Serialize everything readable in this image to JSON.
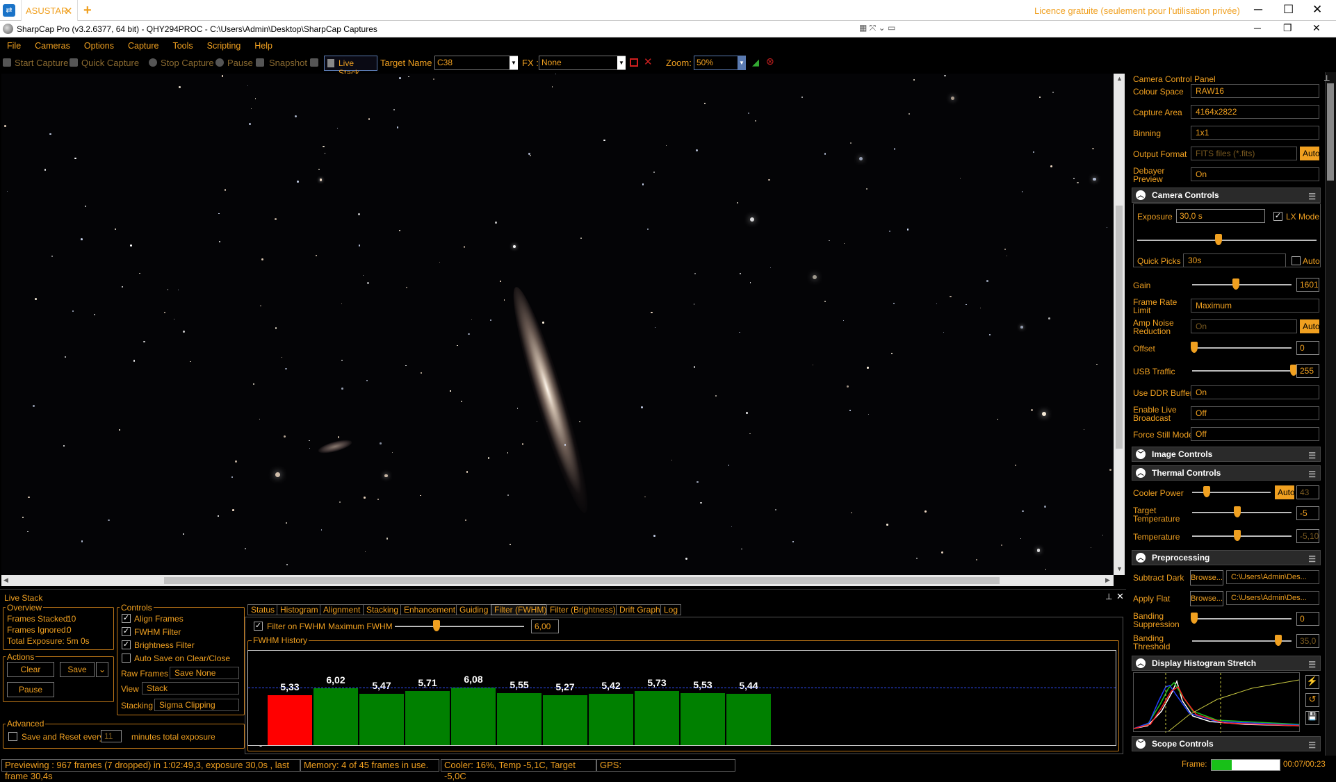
{
  "browser_tab": {
    "title": "ASUSTAR",
    "close": "✕",
    "new": "+",
    "licence": "Licence gratuite (seulement pour l'utilisation privée)"
  },
  "window": {
    "title": "SharpCap Pro (v3.2.6377, 64 bit) - QHY294PROC - C:\\Users\\Admin\\Desktop\\SharpCap Captures"
  },
  "menu": [
    "File",
    "Cameras",
    "Options",
    "Capture",
    "Tools",
    "Scripting",
    "Help"
  ],
  "toolbar": {
    "start_capture": "Start Capture",
    "quick_capture": "Quick Capture",
    "stop_capture": "Stop Capture",
    "pause": "Pause",
    "snapshot": "Snapshot",
    "live_stack": "Live Stack",
    "target_label": "Target Name :",
    "target_value": "C38",
    "fx_label": "FX :",
    "fx_value": "None",
    "zoom_label": "Zoom:",
    "zoom_value": "50%"
  },
  "ccp": {
    "title": "Camera Control Panel",
    "colour_space": {
      "label": "Colour Space",
      "value": "RAW16"
    },
    "capture_area": {
      "label": "Capture Area",
      "value": "4164x2822"
    },
    "binning": {
      "label": "Binning",
      "value": "1x1"
    },
    "output_format": {
      "label": "Output Format",
      "value": "FITS files (*.fits)",
      "auto": "Auto"
    },
    "debayer": {
      "label1": "Debayer",
      "label2": "Preview",
      "value": "On"
    },
    "camera_controls": "Camera Controls",
    "exposure": {
      "label": "Exposure",
      "value": "30,0 s",
      "lx_label": "LX Mode"
    },
    "quick_picks": {
      "label": "Quick Picks",
      "value": "30s",
      "auto": "Auto"
    },
    "gain": {
      "label": "Gain",
      "value": "1601"
    },
    "frame_rate": {
      "label1": "Frame Rate",
      "label2": "Limit",
      "value": "Maximum"
    },
    "amp_noise": {
      "label1": "Amp Noise",
      "label2": "Reduction",
      "value": "On",
      "auto": "Auto"
    },
    "offset": {
      "label": "Offset",
      "value": "0"
    },
    "usb": {
      "label": "USB Traffic",
      "value": "255"
    },
    "ddr": {
      "label": "Use DDR Buffer",
      "value": "On"
    },
    "broadcast": {
      "label1": "Enable Live",
      "label2": "Broadcast",
      "value": "Off"
    },
    "force_still": {
      "label": "Force Still Mode",
      "value": "Off"
    },
    "image_controls": "Image Controls",
    "thermal_controls": "Thermal Controls",
    "cooler_power": {
      "label": "Cooler Power",
      "auto": "Auto",
      "value": "43"
    },
    "target_temp": {
      "label1": "Target",
      "label2": "Temperature",
      "value": "-5"
    },
    "temperature": {
      "label": "Temperature",
      "value": "-5,10"
    },
    "preprocessing": "Preprocessing",
    "subtract_dark": {
      "label": "Subtract Dark",
      "browse": "Browse...",
      "value": "C:\\Users\\Admin\\Des..."
    },
    "apply_flat": {
      "label": "Apply Flat",
      "browse": "Browse...",
      "value": "C:\\Users\\Admin\\Des..."
    },
    "banding_supp": {
      "label1": "Banding",
      "label2": "Suppression",
      "value": "0"
    },
    "banding_thr": {
      "label1": "Banding",
      "label2": "Threshold",
      "value": "35,0"
    },
    "histogram_stretch": "Display Histogram Stretch",
    "scope_controls": "Scope Controls"
  },
  "live_stack": {
    "title": "Live Stack",
    "overview": {
      "title": "Overview",
      "frames_stacked_label": "Frames Stacked:",
      "frames_stacked": "10",
      "frames_ignored_label": "Frames Ignored:",
      "frames_ignored": "0",
      "total_exposure_label": "Total Exposure:",
      "total_exposure": "5m 0s"
    },
    "actions": {
      "title": "Actions",
      "clear": "Clear",
      "save": "Save",
      "pause": "Pause"
    },
    "advanced": {
      "title": "Advanced",
      "save_reset": "Save and Reset every",
      "minutes": "11",
      "minutes_label": "minutes total exposure"
    },
    "controls": {
      "title": "Controls",
      "align": "Align Frames",
      "fwhm": "FWHM Filter",
      "brightness": "Brightness Filter",
      "autosave": "Auto Save on Clear/Close",
      "raw_label": "Raw Frames",
      "raw_value": "Save None",
      "view_label": "View",
      "view_value": "Stack",
      "stacking_label": "Stacking",
      "stacking_value": "Sigma Clipping"
    },
    "tabs": [
      "Status",
      "Histogram",
      "Alignment",
      "Stacking",
      "Enhancement",
      "Guiding",
      "Filter (FWHM)",
      "Filter (Brightness)",
      "Drift Graph",
      "Log"
    ],
    "filter": {
      "checkbox_label": "Filter on FWHM",
      "max_label": "Maximum FWHM",
      "max_value": "6,00",
      "history_title": "FWHM History"
    }
  },
  "chart_data": {
    "type": "bar",
    "title": "FWHM History",
    "ylim": [
      0,
      10
    ],
    "y_ticks": [
      "10",
      "0"
    ],
    "threshold": 6.0,
    "values": [
      5.33,
      6.02,
      5.47,
      5.71,
      6.08,
      5.55,
      5.27,
      5.42,
      5.73,
      5.53,
      5.44
    ],
    "labels": [
      "5,33",
      "6,02",
      "5,47",
      "5,71",
      "6,08",
      "5,55",
      "5,27",
      "5,42",
      "5,73",
      "5,53",
      "5,44"
    ],
    "colors": [
      "#ff0000",
      "#008000",
      "#008000",
      "#008000",
      "#008000",
      "#008000",
      "#008000",
      "#008000",
      "#008000",
      "#008000",
      "#008000"
    ]
  },
  "status": {
    "preview": "Previewing : 967 frames (7 dropped) in 1:02:49,3, exposure 30,0s , last frame 30,4s",
    "memory": "Memory: 4 of 45 frames in use.",
    "cooler": "Cooler: 16%, Temp -5,1C, Target -5,0C",
    "gps": "GPS:",
    "frame_label": "Frame:",
    "frame_time": "00:07/00:23",
    "frame_progress": 0.3
  }
}
